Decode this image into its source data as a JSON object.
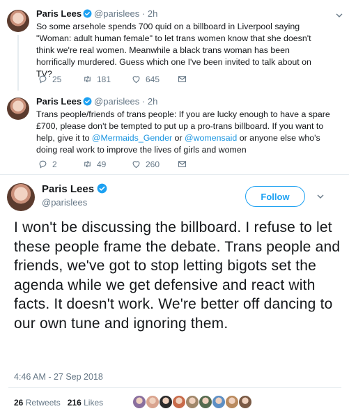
{
  "tweets": [
    {
      "name": "Paris Lees",
      "handle": "@parislees",
      "dot": "·",
      "time": "2h",
      "text": "So some arsehole spends 700 quid on a billboard in Liverpool saying \"Woman: adult human female\" to let trans women know that she doesn't think we're real women. Meanwhile a black trans woman has been horrifically murdered. Guess which one I've been invited to talk about on TV?",
      "replies": "25",
      "retweets": "181",
      "likes": "645"
    },
    {
      "name": "Paris Lees",
      "handle": "@parislees",
      "dot": "·",
      "time": "2h",
      "text_before": "Trans people/friends of trans people: If you are lucky enough to have a spare £700, please don't be tempted to put up a pro-trans billboard. If you want to help, give it to ",
      "mention1": "@Mermaids_Gender",
      "text_middle": " or ",
      "mention2": "@womensaid",
      "text_after": " or anyone else who's doing real work to improve the lives of girls and women",
      "replies": "2",
      "retweets": "49",
      "likes": "260"
    }
  ],
  "main": {
    "name": "Paris Lees",
    "handle": "@parislees",
    "follow_label": "Follow",
    "text": "I won't be discussing the billboard. I refuse to let these people frame the debate. Trans people and friends, we've got to stop letting bigots set the agenda while we get defensive and react with facts. It doesn't work. We're better off dancing to our own tune and ignoring them.",
    "timestamp": "4:46 AM - 27 Sep 2018",
    "retweets_count": "26",
    "retweets_label": "Retweets",
    "likes_count": "216",
    "likes_label": "Likes"
  },
  "colors": {
    "accent": "#1da1f2",
    "muted": "#657786",
    "liker_colors": [
      "#8a6f9e",
      "#d9a48f",
      "#2b2b2b",
      "#c86b4a",
      "#a0876a",
      "#556b4f",
      "#5d8fc4",
      "#b98a5e",
      "#7a5a45"
    ]
  }
}
